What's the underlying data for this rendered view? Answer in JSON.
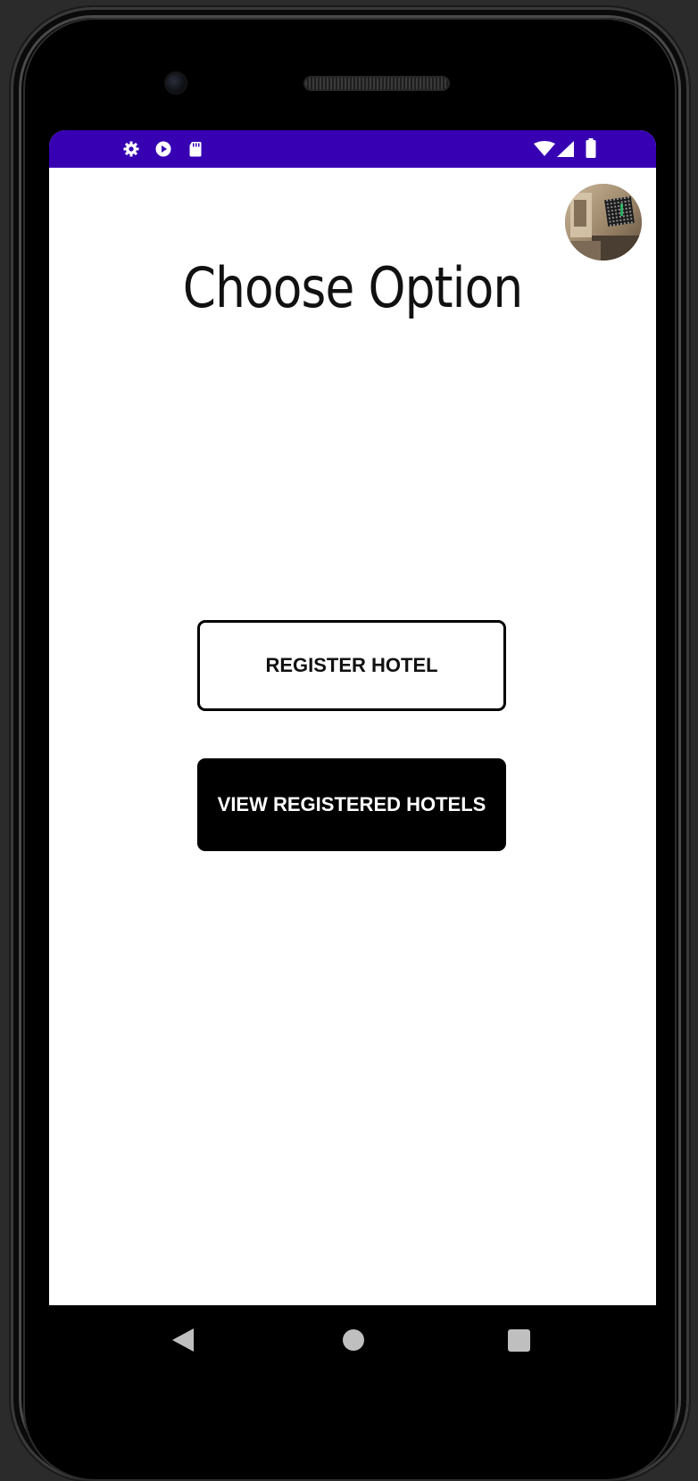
{
  "screen": {
    "title": "Choose Option"
  },
  "actions": {
    "register_hotel_label": "REGISTER HOTEL",
    "view_registered_hotels_label": "VIEW REGISTERED HOTELS"
  },
  "status_bar": {
    "color": "#3700b3",
    "left_icons": [
      "settings-icon",
      "play-protect-icon",
      "sd-card-icon"
    ],
    "right_icons": [
      "wifi-icon",
      "signal-icon",
      "battery-icon"
    ]
  },
  "avatar": {
    "icon": "hotel-room-avatar"
  },
  "nav_bar": {
    "items": [
      "back-icon",
      "home-icon",
      "recent-apps-icon"
    ]
  },
  "colors": {
    "primary": "#3700b3",
    "button_filled_bg": "#000000",
    "button_outline_border": "#000000",
    "background": "#ffffff"
  }
}
